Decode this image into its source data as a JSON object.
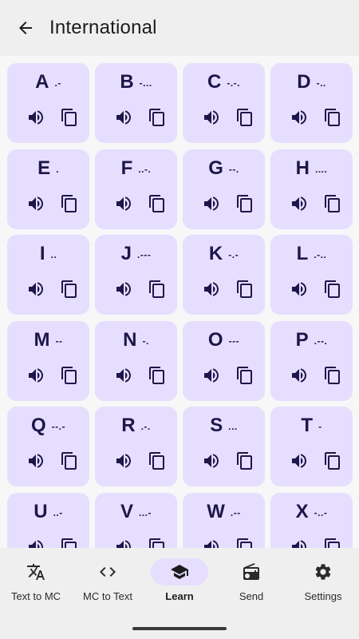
{
  "appbar": {
    "title": "International",
    "back_icon": "arrow-back-icon"
  },
  "letters": [
    {
      "letter": "A",
      "code": ".-"
    },
    {
      "letter": "B",
      "code": "-..."
    },
    {
      "letter": "C",
      "code": "-.-."
    },
    {
      "letter": "D",
      "code": "-.."
    },
    {
      "letter": "E",
      "code": "."
    },
    {
      "letter": "F",
      "code": "..-."
    },
    {
      "letter": "G",
      "code": "--."
    },
    {
      "letter": "H",
      "code": "...."
    },
    {
      "letter": "I",
      "code": ".."
    },
    {
      "letter": "J",
      "code": ".---"
    },
    {
      "letter": "K",
      "code": "-.-"
    },
    {
      "letter": "L",
      "code": ".-.."
    },
    {
      "letter": "M",
      "code": "--"
    },
    {
      "letter": "N",
      "code": "-."
    },
    {
      "letter": "O",
      "code": "---"
    },
    {
      "letter": "P",
      "code": ".--."
    },
    {
      "letter": "Q",
      "code": "--.-"
    },
    {
      "letter": "R",
      "code": ".-."
    },
    {
      "letter": "S",
      "code": "..."
    },
    {
      "letter": "T",
      "code": "-"
    },
    {
      "letter": "U",
      "code": "..-"
    },
    {
      "letter": "V",
      "code": "...-"
    },
    {
      "letter": "W",
      "code": ".--"
    },
    {
      "letter": "X",
      "code": "-..-"
    }
  ],
  "card_icons": {
    "play": "volume-up-icon",
    "copy": "copy-icon"
  },
  "bottom_nav": [
    {
      "label": "Text to MC",
      "icon": "translate-icon",
      "active": false
    },
    {
      "label": "MC to Text",
      "icon": "code-icon",
      "active": false
    },
    {
      "label": "Learn",
      "icon": "school-icon",
      "active": true
    },
    {
      "label": "Send",
      "icon": "radio-icon",
      "active": false
    },
    {
      "label": "Settings",
      "icon": "settings-icon",
      "active": false
    }
  ],
  "colors": {
    "card_bg": "#e6defe",
    "text_primary": "#1e164a",
    "active_pill": "#e6defe",
    "background": "#f7f7f7"
  }
}
